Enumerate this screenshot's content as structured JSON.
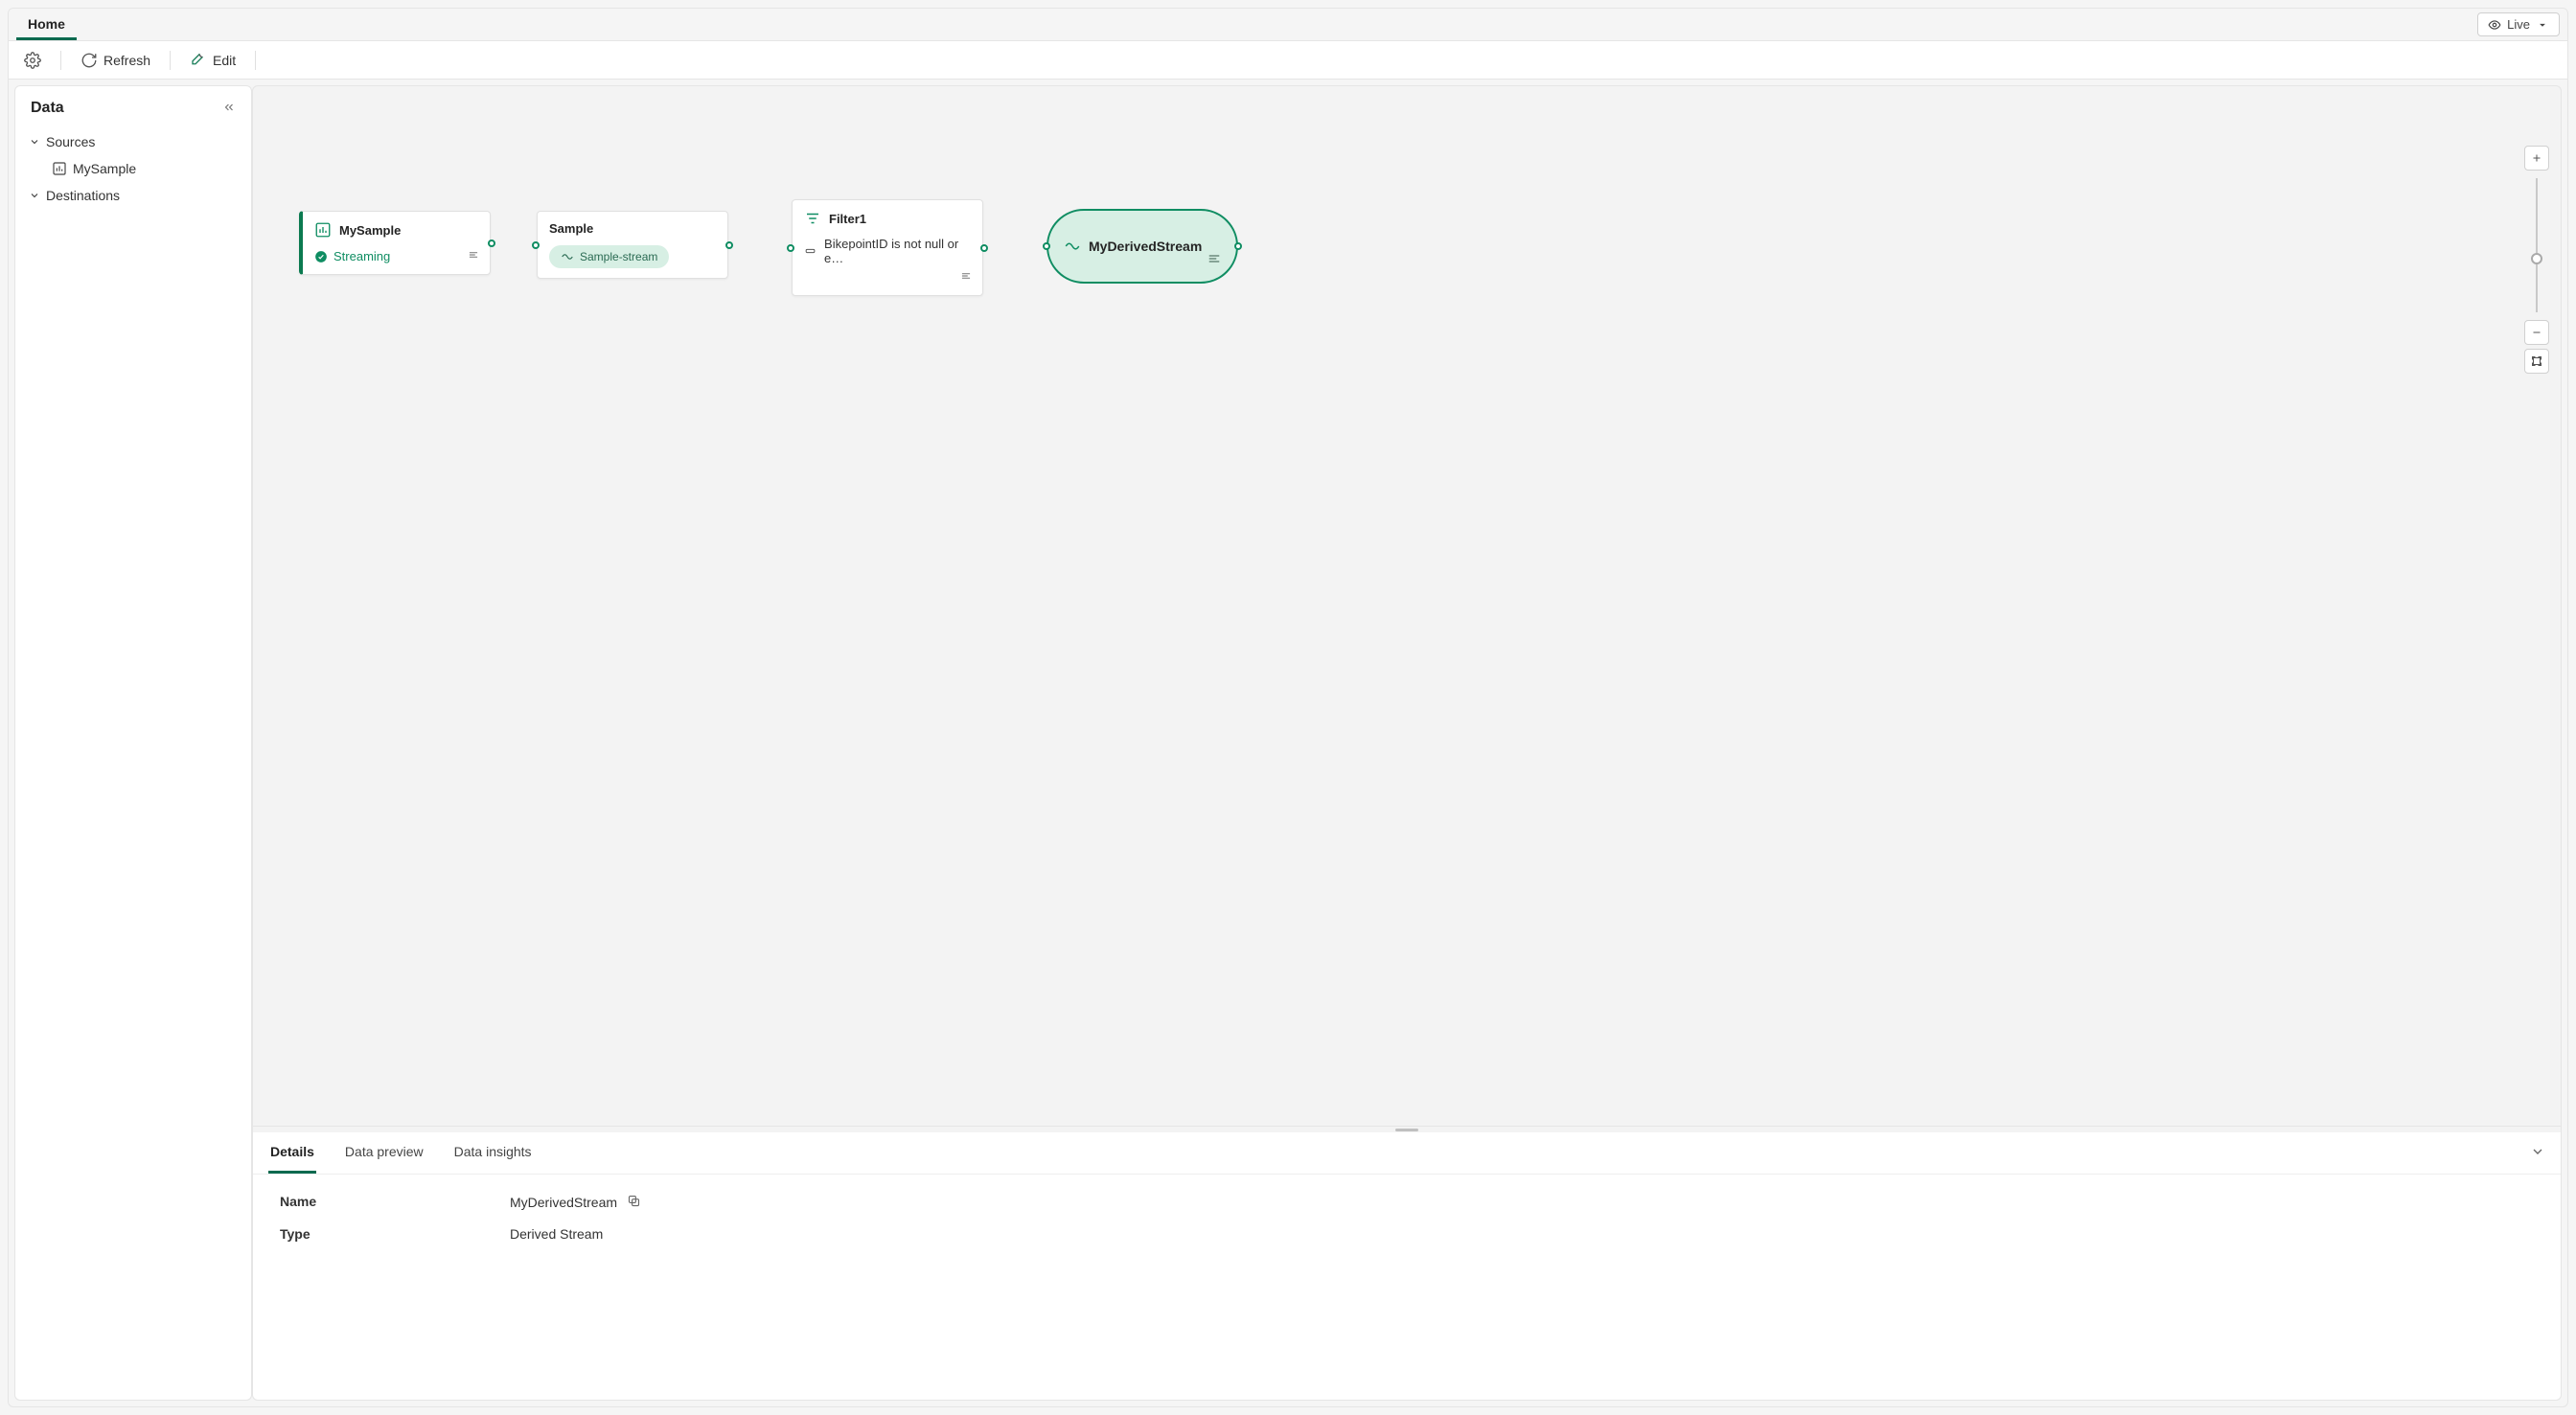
{
  "ribbon": {
    "tabs": [
      {
        "label": "Home"
      }
    ],
    "live_label": "Live"
  },
  "toolbar": {
    "refresh_label": "Refresh",
    "edit_label": "Edit"
  },
  "sidebar": {
    "title": "Data",
    "sections": {
      "sources_label": "Sources",
      "destinations_label": "Destinations"
    },
    "sources": [
      {
        "label": "MySample"
      }
    ]
  },
  "nodes": {
    "source": {
      "title": "MySample",
      "status": "Streaming"
    },
    "sample": {
      "title": "Sample",
      "chip": "Sample-stream"
    },
    "filter": {
      "title": "Filter1",
      "desc": "BikepointID is not null or e…"
    },
    "derived": {
      "title": "MyDerivedStream"
    }
  },
  "details": {
    "tabs": [
      {
        "label": "Details"
      },
      {
        "label": "Data preview"
      },
      {
        "label": "Data insights"
      }
    ],
    "rows": {
      "name_label": "Name",
      "name_value": "MyDerivedStream",
      "type_label": "Type",
      "type_value": "Derived Stream"
    }
  }
}
